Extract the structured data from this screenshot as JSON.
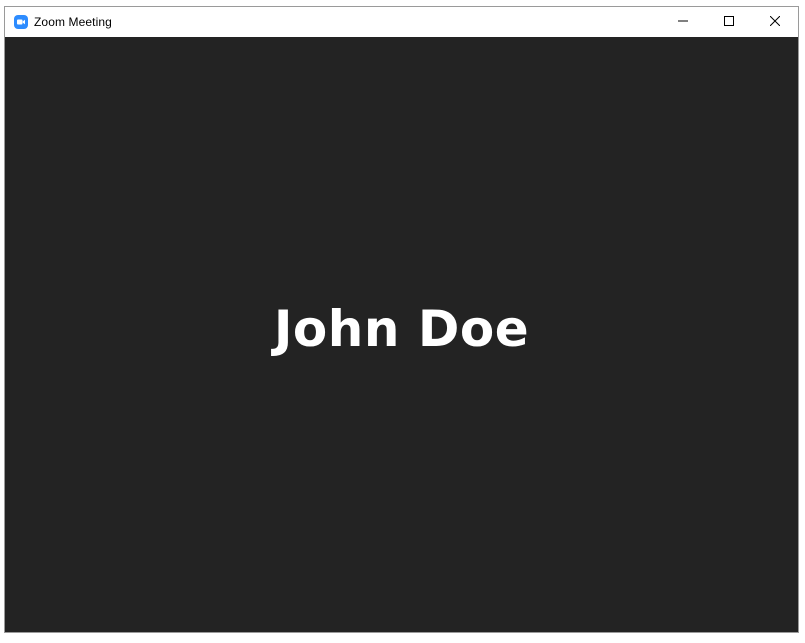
{
  "window": {
    "title": "Zoom Meeting",
    "app_icon": "zoom-camera-icon",
    "accent_color": "#2d8cff",
    "controls": {
      "minimize_icon": "minimize-icon",
      "maximize_icon": "maximize-icon",
      "close_icon": "close-icon"
    }
  },
  "meeting": {
    "participant_name": "John Doe",
    "background_color": "#232323"
  }
}
